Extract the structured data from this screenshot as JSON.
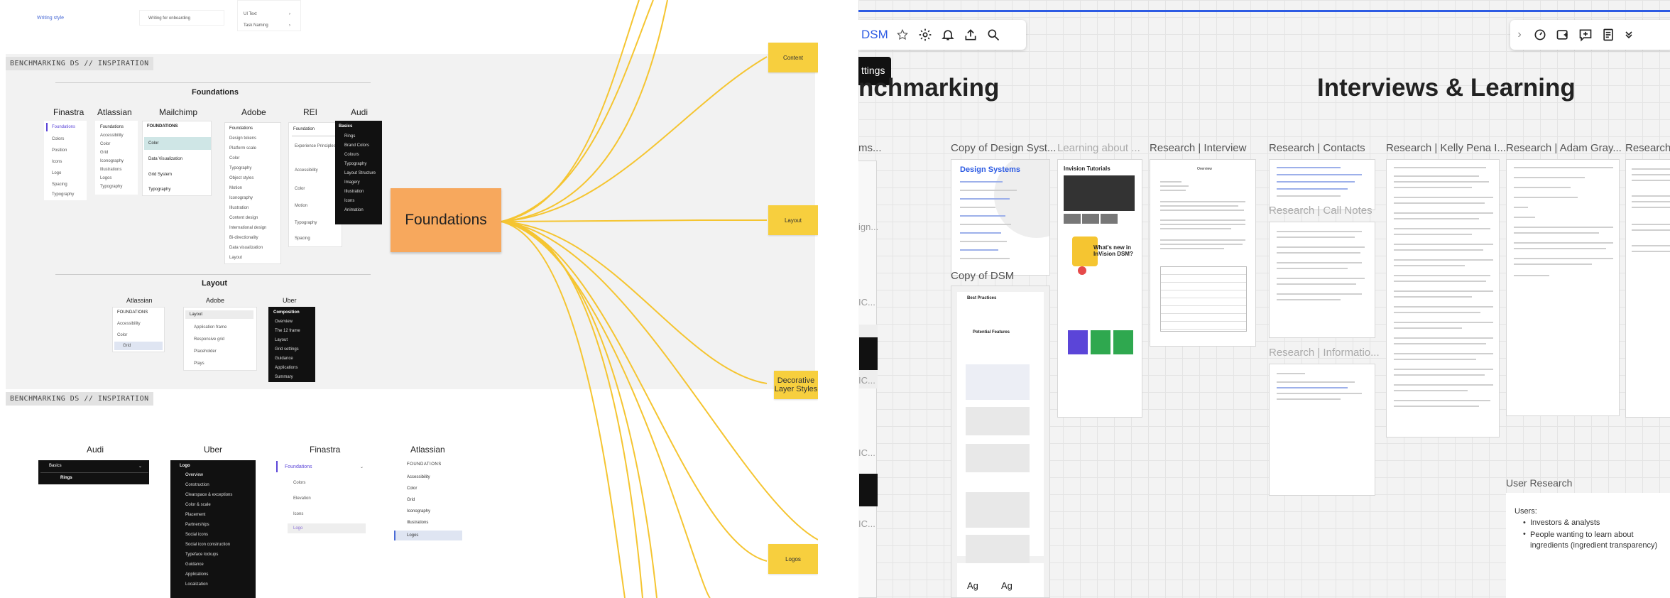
{
  "left": {
    "top_rows": {
      "a": "Writing style",
      "b": "Writing for onboarding",
      "c": "UI Text",
      "d": "Task Naming"
    },
    "section1": {
      "tag": "BENCHMARKING DS // INSPIRATION",
      "foundations_title": "Foundations",
      "columns": [
        {
          "name": "Finastra",
          "items": [
            "Foundations",
            "Colors",
            "Position",
            "Icons",
            "Logo",
            "Spacing",
            "Typography"
          ]
        },
        {
          "name": "Atlassian",
          "items": [
            "Foundations",
            "Accessibility",
            "Color",
            "Grid",
            "Iconography",
            "Illustrations",
            "Logos",
            "Typography"
          ]
        },
        {
          "name": "Mailchimp",
          "items": [
            "FOUNDATIONS",
            "Color",
            "Data Visualization",
            "Grid System",
            "Typography"
          ]
        },
        {
          "name": "Adobe",
          "items": [
            "Foundations",
            "Design tokens",
            "Platform scale",
            "Color",
            "Typography",
            "Object styles",
            "Motion",
            "Iconography",
            "Illustration",
            "Content design",
            "International design",
            "Bi-directionality",
            "Data visualization",
            "Layout"
          ]
        },
        {
          "name": "REI",
          "items": [
            "Foundation",
            "Experience Principles",
            "Accessibility",
            "Color",
            "Motion",
            "Typography",
            "Spacing"
          ]
        },
        {
          "name": "Audi",
          "items": [
            "Basics",
            "Rings",
            "Brand Colors",
            "Colours",
            "Typography",
            "Layout Structure",
            "Imagery",
            "Illustration",
            "Icons",
            "Animation"
          ]
        }
      ],
      "layout_title": "Layout",
      "layout_cols": [
        {
          "name": "Atlassian",
          "items": [
            "FOUNDATIONS",
            "Accessibility",
            "Color",
            "Grid"
          ]
        },
        {
          "name": "Adobe",
          "items": [
            "Layout",
            "Application frame",
            "Responsive grid",
            "Placeholder",
            "Plays"
          ]
        },
        {
          "name": "Uber",
          "items": [
            "Composition",
            "Overview",
            "The 12 frame",
            "Layout",
            "Grid settings",
            "Guidance",
            "Applications",
            "Summary"
          ]
        }
      ]
    },
    "section2": {
      "tag": "BENCHMARKING DS // INSPIRATION",
      "cols": [
        {
          "name": "Audi",
          "items": [
            "Basics",
            "Rings"
          ]
        },
        {
          "name": "Uber",
          "items": [
            "Logo",
            "Overview",
            "Construction",
            "Clearspace & exceptions",
            "Color & scale",
            "Placement",
            "Partnerships",
            "Social icons",
            "Social icon construction",
            "Typeface lockups",
            "Guidance",
            "Applications",
            "Localization"
          ]
        },
        {
          "name": "Finastra",
          "items": [
            "Foundations",
            "Colors",
            "Elevation",
            "Icons",
            "Logo"
          ]
        },
        {
          "name": "Atlassian",
          "items": [
            "FOUNDATIONS",
            "Accessibility",
            "Color",
            "Grid",
            "Iconography",
            "Illustrations",
            "Logos"
          ]
        }
      ]
    },
    "center_sticky": "Foundations",
    "stickies": [
      "Content",
      "Layout",
      "Decorative Layer Styles",
      "Logos"
    ],
    "colors": {
      "sticky": "#f7cf3e",
      "center": "#f7a85d",
      "connector": "#f5c531"
    }
  },
  "right": {
    "toolbar_left": {
      "title": "DSM",
      "icons": [
        "star-icon",
        "settings-icon",
        "bell-icon",
        "upload-icon",
        "search-icon"
      ]
    },
    "tooltip": "ttings",
    "toolbar_right": {
      "icons": [
        "chevron-right-icon",
        "timer-icon",
        "frame-add-icon",
        "comment-add-icon",
        "notes-icon",
        "chevrons-down-icon"
      ]
    },
    "heading_left": "nchmarking",
    "heading_right": "Interviews & Learning",
    "frames": [
      "ms...",
      "Copy of Design Syst...",
      "Learning about ...",
      "Research | Interview",
      "Research | Contacts",
      "Research | Kelly Pena I...",
      "Research | Adam Gray...",
      "Research",
      "Copy of DSM",
      "Research | Call Notes",
      "Research | Informatio..."
    ],
    "side_frags": [
      "ign...",
      "IC...",
      "IC...",
      "IC...",
      "IC..."
    ],
    "doc_texts": {
      "design_systems": "Design Systems",
      "invision": "Invision Tutorials",
      "whats_new": "What's new in InVision DSM?",
      "best_practices": "Best Practices",
      "potential": "Potential Features",
      "ag": "Ag",
      "ag2": "Ag",
      "overview": "Overview"
    },
    "user_research": {
      "title": "User Research",
      "heading": "Users:",
      "bullets": [
        "Investors & analysts",
        "People wanting to learn about ingredients (ingredient transparency)"
      ]
    },
    "accent": "#2d5be3"
  }
}
